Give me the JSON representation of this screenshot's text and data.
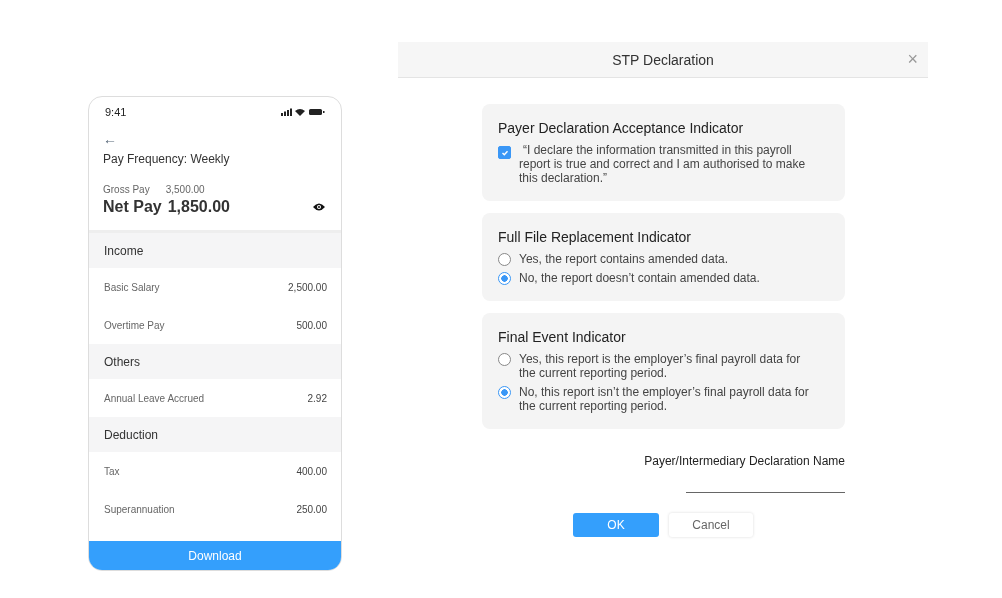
{
  "phone": {
    "status_time": "9:41",
    "back": "←",
    "pay_frequency": "Pay Frequency: Weekly",
    "gross_label": "Gross Pay",
    "gross_value": "3,500.00",
    "net_label": "Net Pay",
    "net_value": "1,850.00",
    "rows": [
      {
        "kind": "header",
        "label": "Income"
      },
      {
        "kind": "item",
        "label": "Basic Salary",
        "value": "2,500.00"
      },
      {
        "kind": "item",
        "label": "Overtime Pay",
        "value": "500.00"
      },
      {
        "kind": "header",
        "label": "Others"
      },
      {
        "kind": "item",
        "label": "Annual Leave Accrued",
        "value": "2.92"
      },
      {
        "kind": "header",
        "label": "Deduction"
      },
      {
        "kind": "item",
        "label": "Tax",
        "value": "400.00"
      },
      {
        "kind": "item",
        "label": "Superannuation",
        "value": "250.00"
      }
    ],
    "download": "Download"
  },
  "dialog": {
    "title": "STP Declaration",
    "close": "×",
    "cards": [
      {
        "kind": "checkbox",
        "title": "Payer Declaration Acceptance Indicator",
        "options": [
          {
            "label": "“I declare the information transmitted in this payroll report is true and correct and I am authorised to make this declaration.”",
            "checked": true
          }
        ]
      },
      {
        "kind": "radio",
        "title": "Full File Replacement Indicator",
        "options": [
          {
            "label": "Yes, the report contains amended data.",
            "selected": false
          },
          {
            "label": "No, the report doesn’t contain amended data.",
            "selected": true
          }
        ]
      },
      {
        "kind": "radio",
        "title": "Final Event Indicator",
        "options": [
          {
            "label": "Yes, this report is the employer’s final payroll data for the current reporting period.",
            "selected": false
          },
          {
            "label": "No, this report isn’t the employer’s final payroll data for the current reporting period.",
            "selected": true
          }
        ]
      }
    ],
    "name_label": "Payer/Intermediary Declaration Name",
    "ok": "OK",
    "cancel": "Cancel"
  }
}
